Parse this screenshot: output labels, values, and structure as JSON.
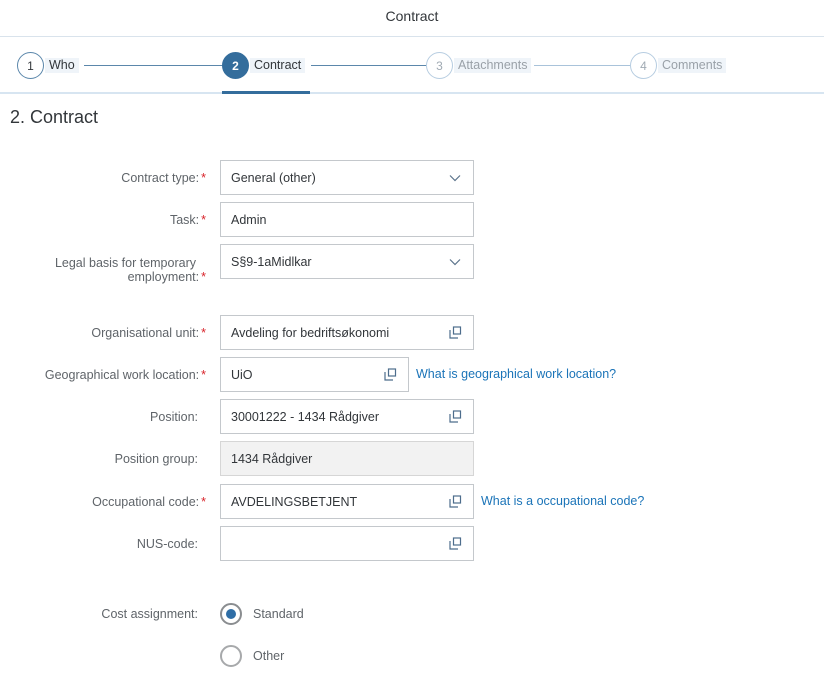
{
  "header": {
    "title": "Contract"
  },
  "wizard": {
    "steps": [
      {
        "number": "1",
        "label": "Who",
        "state": "completed"
      },
      {
        "number": "2",
        "label": "Contract",
        "state": "active"
      },
      {
        "number": "3",
        "label": "Attachments",
        "state": "disabled"
      },
      {
        "number": "4",
        "label": "Comments",
        "state": "disabled"
      }
    ]
  },
  "section": {
    "title": "2. Contract"
  },
  "form": {
    "contract_type": {
      "label": "Contract type:",
      "required": true,
      "value": "General (other)",
      "control": "select",
      "icon": "chevron-down-icon"
    },
    "task": {
      "label": "Task:",
      "required": true,
      "value": "Admin",
      "control": "input"
    },
    "legal_basis": {
      "label_line1": "Legal basis for temporary",
      "label_line2": "employment:",
      "required": true,
      "value": "S§9-1aMidlkar",
      "control": "select",
      "icon": "chevron-down-icon"
    },
    "org_unit": {
      "label": "Organisational unit:",
      "required": true,
      "value": "Avdeling for bedriftsøkonomi",
      "control": "value-help",
      "icon": "value-help-icon"
    },
    "geo_location": {
      "label": "Geographical work location:",
      "required": true,
      "value": "UiO",
      "control": "value-help",
      "icon": "value-help-icon",
      "help_link": "What is geographical work location?"
    },
    "position": {
      "label": "Position:",
      "required": false,
      "value": "30001222 - 1434 Rådgiver",
      "control": "value-help",
      "icon": "value-help-icon"
    },
    "position_group": {
      "label": "Position group:",
      "required": false,
      "value": "1434 Rådgiver",
      "control": "readonly"
    },
    "occupational_code": {
      "label": "Occupational code:",
      "required": true,
      "value": "AVDELINGSBETJENT",
      "control": "value-help",
      "icon": "value-help-icon",
      "help_link": "What is a occupational code?"
    },
    "nus_code": {
      "label": "NUS-code:",
      "required": false,
      "value": "",
      "control": "value-help",
      "icon": "value-help-icon"
    },
    "cost_assignment": {
      "label": "Cost assignment:",
      "options": [
        {
          "label": "Standard",
          "selected": true
        },
        {
          "label": "Other",
          "selected": false
        }
      ]
    },
    "required_marker": "*"
  },
  "colors": {
    "accent": "#346d9c",
    "link": "#1b74b8",
    "required": "#d8232a",
    "border": "#c4c8cc",
    "readonly_bg": "#f2f2f2"
  }
}
